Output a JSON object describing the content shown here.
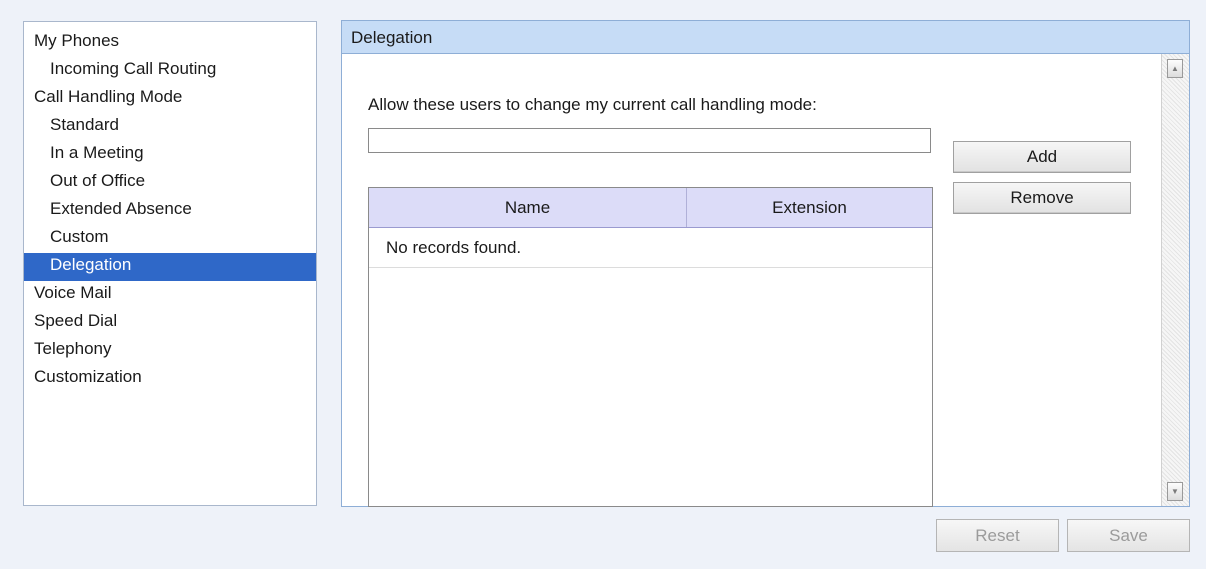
{
  "sidebar": {
    "items": [
      {
        "label": "My Phones",
        "level": 0,
        "selected": false
      },
      {
        "label": "Incoming Call Routing",
        "level": 1,
        "selected": false
      },
      {
        "label": "Call Handling Mode",
        "level": 0,
        "selected": false
      },
      {
        "label": "Standard",
        "level": 1,
        "selected": false
      },
      {
        "label": "In a Meeting",
        "level": 1,
        "selected": false
      },
      {
        "label": "Out of Office",
        "level": 1,
        "selected": false
      },
      {
        "label": "Extended Absence",
        "level": 1,
        "selected": false
      },
      {
        "label": "Custom",
        "level": 1,
        "selected": false
      },
      {
        "label": "Delegation",
        "level": 1,
        "selected": true
      },
      {
        "label": "Voice Mail",
        "level": 0,
        "selected": false
      },
      {
        "label": "Speed Dial",
        "level": 0,
        "selected": false
      },
      {
        "label": "Telephony",
        "level": 0,
        "selected": false
      },
      {
        "label": "Customization",
        "level": 0,
        "selected": false
      }
    ]
  },
  "panel": {
    "title": "Delegation",
    "instruction": "Allow these users to change my current call handling mode:",
    "user_input": {
      "value": "",
      "placeholder": ""
    },
    "add_label": "Add",
    "remove_label": "Remove",
    "table": {
      "columns": [
        "Name",
        "Extension"
      ],
      "empty_message": "No records found."
    }
  },
  "footer": {
    "reset_label": "Reset",
    "save_label": "Save"
  },
  "colors": {
    "selected_bg": "#2f68c8",
    "header_bg": "#c6dcf6",
    "grid_header_bg": "#dcdcf8"
  }
}
